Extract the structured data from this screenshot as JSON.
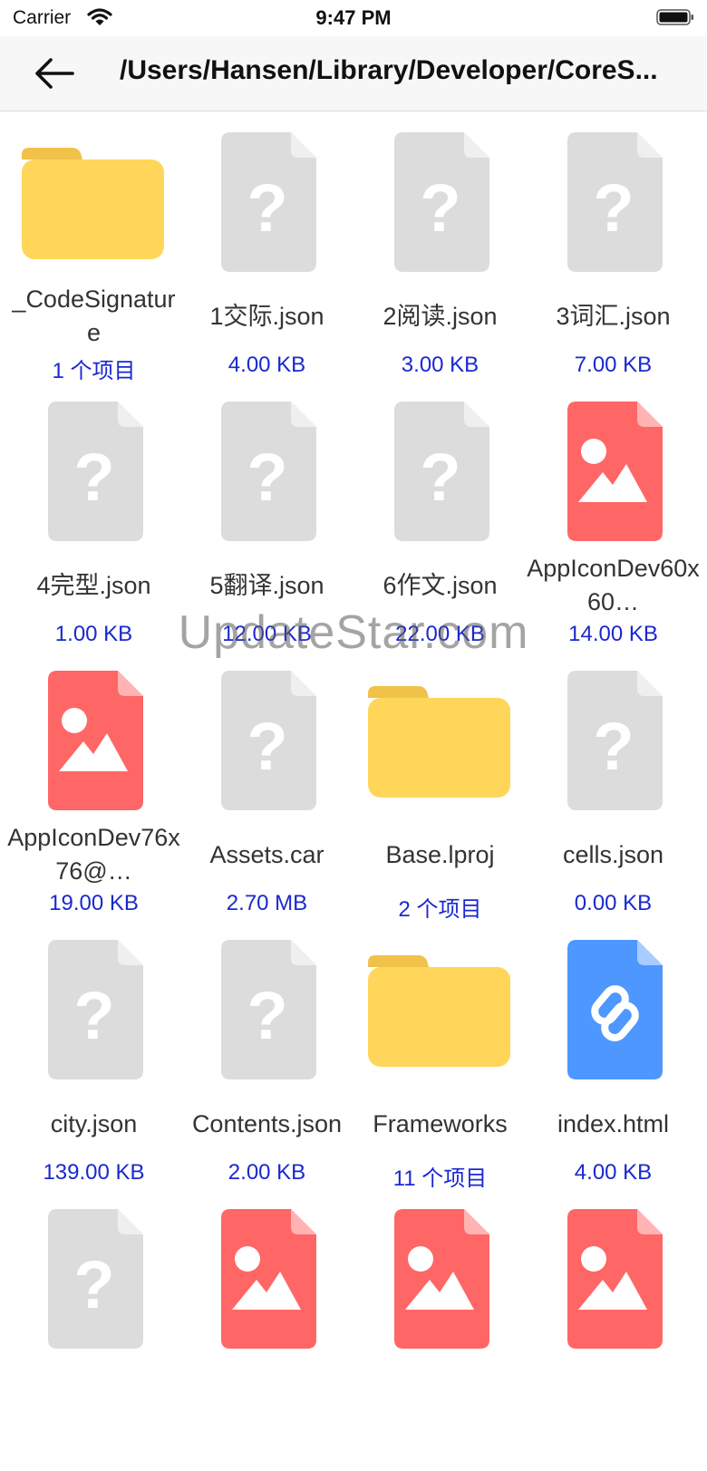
{
  "status_bar": {
    "carrier": "Carrier",
    "time": "9:47 PM"
  },
  "nav": {
    "title": "/Users/Hansen/Library/Developer/CoreS..."
  },
  "watermark": "UpdateStar.com",
  "colors": {
    "folder": "#FFD65A",
    "folder_tab": "#F0C24A",
    "unknown": "#DCDCDC",
    "image": "#FF6666",
    "link": "#4D97FF",
    "size_text": "#1A28D0"
  },
  "items": [
    {
      "type": "folder-icon",
      "name": "_CodeSignature",
      "size": "1 个项目"
    },
    {
      "type": "unknown-file-icon",
      "name": "1交际.json",
      "size": "4.00 KB"
    },
    {
      "type": "unknown-file-icon",
      "name": "2阅读.json",
      "size": "3.00 KB"
    },
    {
      "type": "unknown-file-icon",
      "name": "3词汇.json",
      "size": "7.00 KB"
    },
    {
      "type": "unknown-file-icon",
      "name": "4完型.json",
      "size": "1.00 KB"
    },
    {
      "type": "unknown-file-icon",
      "name": "5翻译.json",
      "size": "12.00 KB"
    },
    {
      "type": "unknown-file-icon",
      "name": "6作文.json",
      "size": "22.00 KB"
    },
    {
      "type": "image-file-icon",
      "name": "AppIconDev60x60…",
      "size": "14.00 KB"
    },
    {
      "type": "image-file-icon",
      "name": "AppIconDev76x76@…",
      "size": "19.00 KB"
    },
    {
      "type": "unknown-file-icon",
      "name": "Assets.car",
      "size": "2.70 MB"
    },
    {
      "type": "folder-icon",
      "name": "Base.lproj",
      "size": "2 个项目"
    },
    {
      "type": "unknown-file-icon",
      "name": "cells.json",
      "size": "0.00 KB"
    },
    {
      "type": "unknown-file-icon",
      "name": "city.json",
      "size": "139.00 KB"
    },
    {
      "type": "unknown-file-icon",
      "name": "Contents.json",
      "size": "2.00 KB"
    },
    {
      "type": "folder-icon",
      "name": "Frameworks",
      "size": "11 个项目"
    },
    {
      "type": "link-file-icon",
      "name": "index.html",
      "size": "4.00 KB"
    },
    {
      "type": "unknown-file-icon",
      "name": "",
      "size": ""
    },
    {
      "type": "image-file-icon",
      "name": "",
      "size": ""
    },
    {
      "type": "image-file-icon",
      "name": "",
      "size": ""
    },
    {
      "type": "image-file-icon",
      "name": "",
      "size": ""
    }
  ]
}
